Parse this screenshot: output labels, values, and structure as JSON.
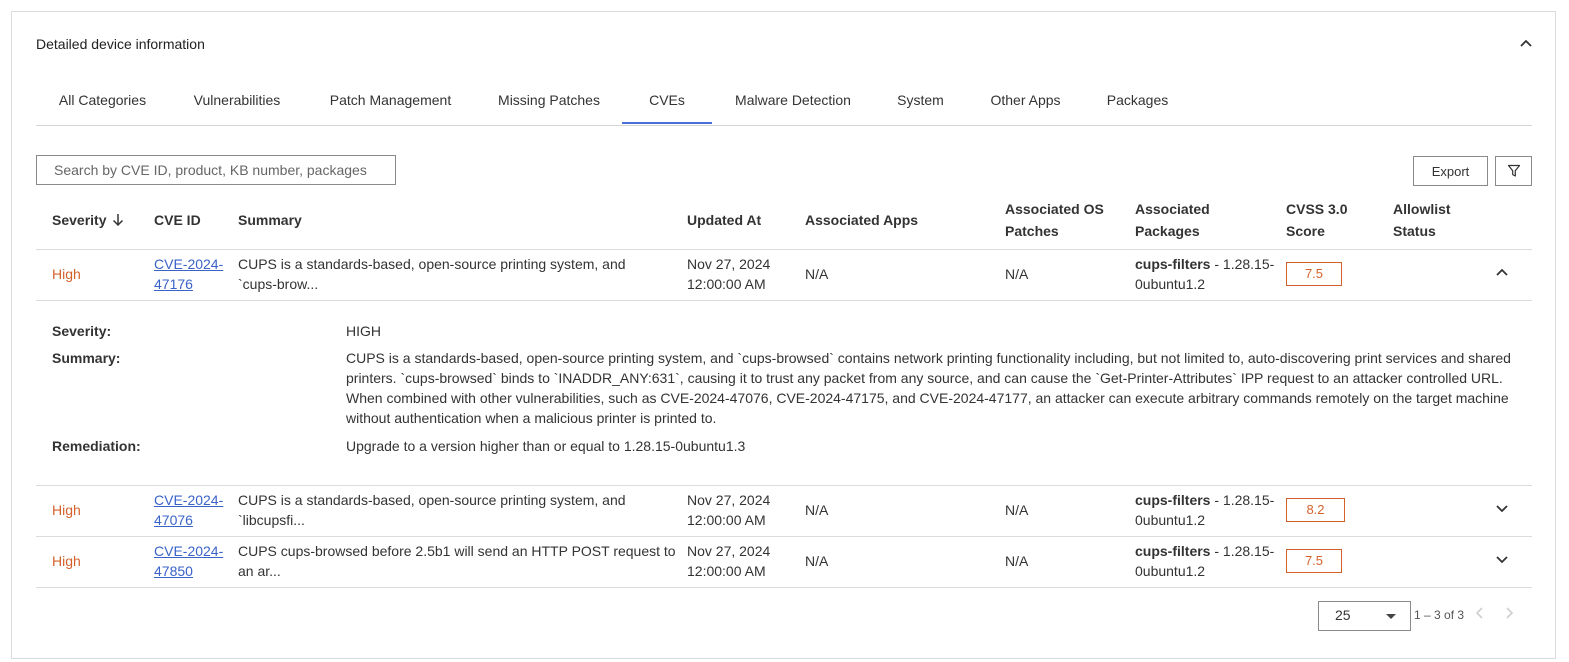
{
  "card": {
    "title": "Detailed device information"
  },
  "tabs": [
    {
      "label": "All Categories"
    },
    {
      "label": "Vulnerabilities"
    },
    {
      "label": "Patch Management"
    },
    {
      "label": "Missing Patches"
    },
    {
      "label": "CVEs",
      "active": true
    },
    {
      "label": "Malware Detection"
    },
    {
      "label": "System"
    },
    {
      "label": "Other Apps"
    },
    {
      "label": "Packages"
    }
  ],
  "search": {
    "placeholder": "Search by CVE ID, product, KB number, packages",
    "value": ""
  },
  "toolbar": {
    "export_label": "Export"
  },
  "table": {
    "headers": {
      "severity": "Severity",
      "cve_id": "CVE ID",
      "summary": "Summary",
      "updated_at": "Updated At",
      "apps": "Associated Apps",
      "os_patches_1": "Associated OS",
      "os_patches_2": "Patches",
      "packages_1": "Associated",
      "packages_2": "Packages",
      "cvss_1": "CVSS 3.0",
      "cvss_2": "Score",
      "allowlist_1": "Allowlist",
      "allowlist_2": "Status"
    },
    "rows": [
      {
        "severity": "High",
        "cve_1": "CVE-2024-",
        "cve_2": "47176",
        "summary_1": "CUPS is a standards-based, open-source printing system, and",
        "summary_2": "`cups-brow...",
        "updated_1": "Nov 27, 2024",
        "updated_2": "12:00:00 AM",
        "apps": "N/A",
        "os_patches": "N/A",
        "package_name": "cups-filters",
        "package_ver_1": " - 1.28.15-",
        "package_ver_2": "0ubuntu1.2",
        "score": "7.5",
        "expanded": true
      },
      {
        "severity": "High",
        "cve_1": "CVE-2024-",
        "cve_2": "47076",
        "summary_1": "CUPS is a standards-based, open-source printing system, and",
        "summary_2": "`libcupsfi...",
        "updated_1": "Nov 27, 2024",
        "updated_2": "12:00:00 AM",
        "apps": "N/A",
        "os_patches": "N/A",
        "package_name": "cups-filters",
        "package_ver_1": " - 1.28.15-",
        "package_ver_2": "0ubuntu1.2",
        "score": "8.2",
        "expanded": false
      },
      {
        "severity": "High",
        "cve_1": "CVE-2024-",
        "cve_2": "47850",
        "summary_1": "CUPS cups-browsed before 2.5b1 will send an HTTP POST request to",
        "summary_2": "an ar...",
        "updated_1": "Nov 27, 2024",
        "updated_2": "12:00:00 AM",
        "apps": "N/A",
        "os_patches": "N/A",
        "package_name": "cups-filters",
        "package_ver_1": " - 1.28.15-",
        "package_ver_2": "0ubuntu1.2",
        "score": "7.5",
        "expanded": false
      }
    ]
  },
  "detail": {
    "severity_label": "Severity:",
    "severity_value": "HIGH",
    "summary_label": "Summary:",
    "summary_value": "CUPS is a standards-based, open-source printing system, and `cups-browsed` contains network printing functionality including, but not limited to, auto-discovering print services and shared printers. `cups-browsed` binds to `INADDR_ANY:631`, causing it to trust any packet from any source, and can cause the `Get-Printer-Attributes` IPP request to an attacker controlled URL. When combined with other vulnerabilities, such as CVE-2024-47076, CVE-2024-47175, and CVE-2024-47177, an attacker can execute arbitrary commands remotely on the target machine without authentication when a malicious printer is printed to.",
    "remediation_label": "Remediation:",
    "remediation_value": "Upgrade to a version higher than or equal to 1.28.15-0ubuntu1.3"
  },
  "pagination": {
    "page_size": "25",
    "range": "1 – 3 of 3"
  },
  "colors": {
    "accent": "#4a6fd6",
    "severity_high": "#d4612a",
    "link": "#3a63c8"
  }
}
